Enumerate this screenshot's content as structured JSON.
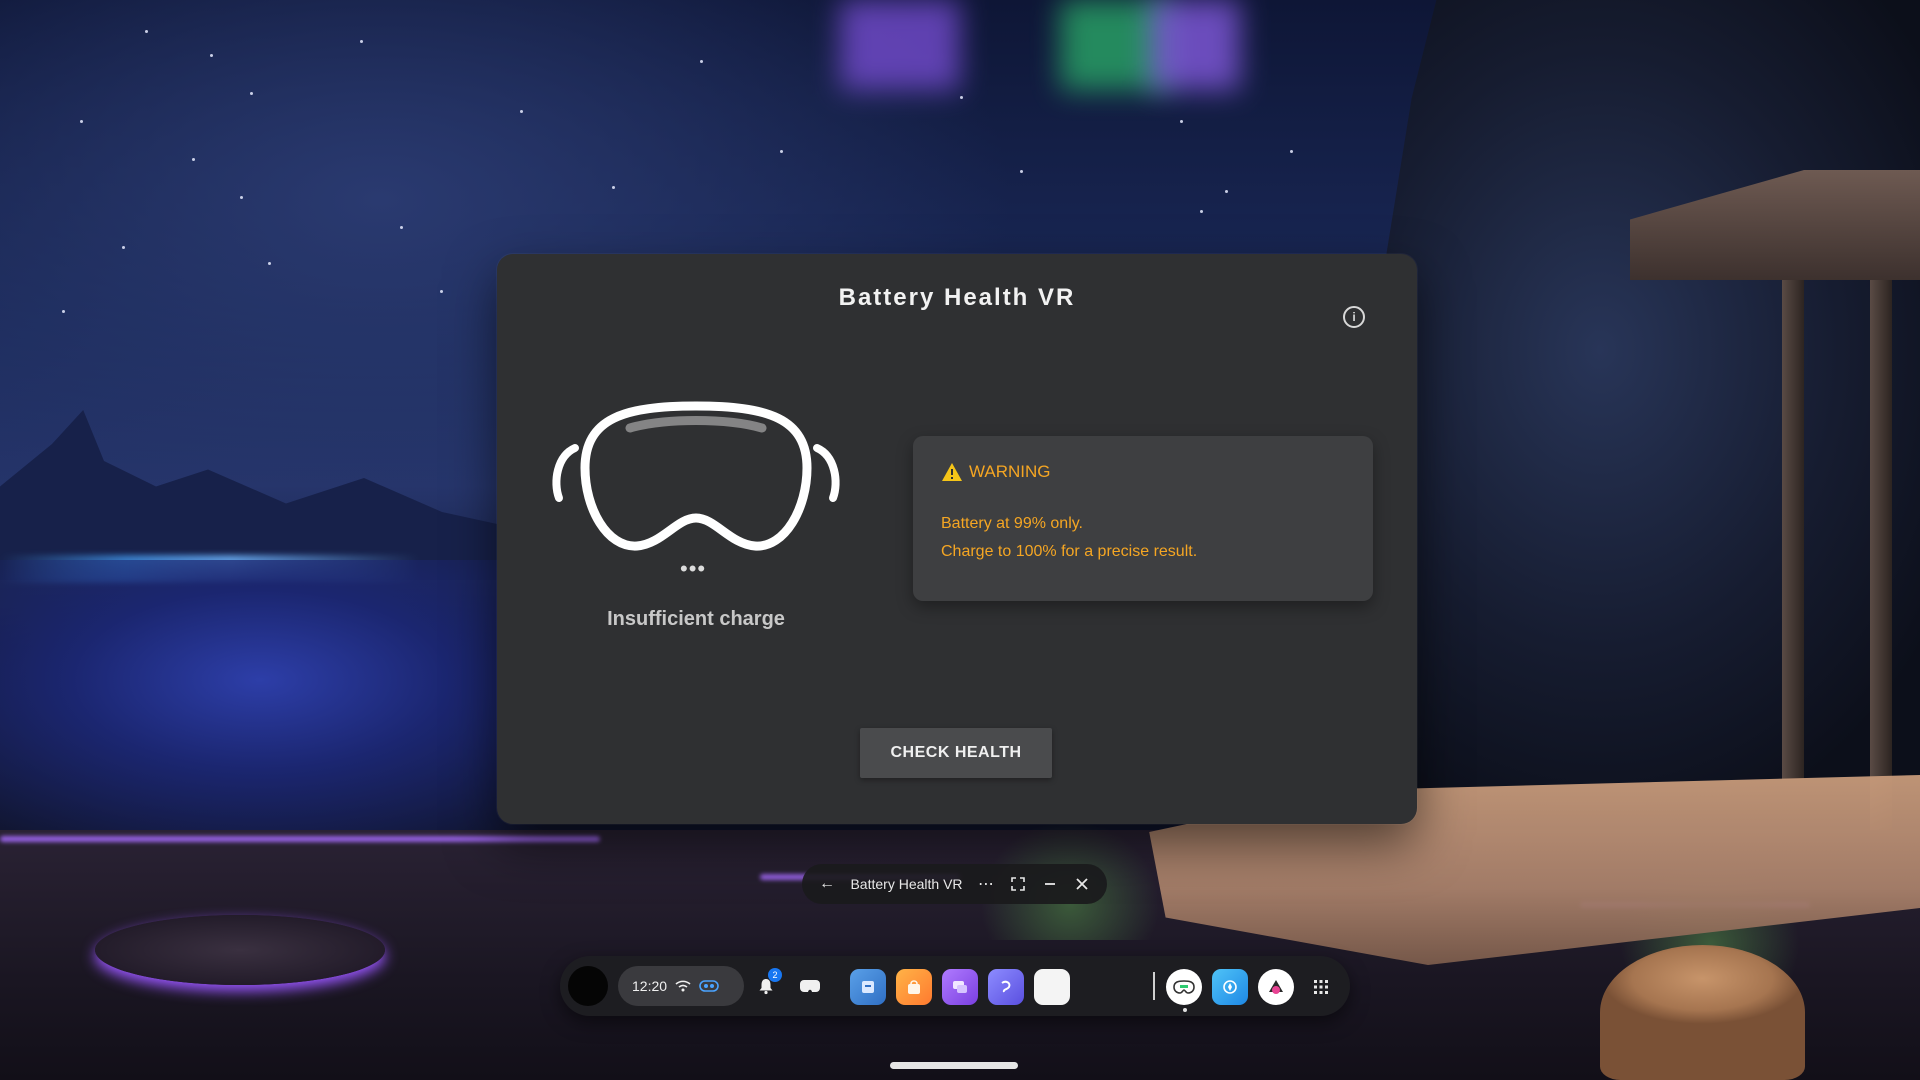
{
  "app": {
    "title": "Battery Health VR",
    "status_label": "Insufficient charge",
    "dots": "•••",
    "info_icon": "info-icon",
    "warning": {
      "heading": "WARNING",
      "line1": "Battery at 99% only.",
      "line2": "Charge to 100% for a precise result.",
      "color": "#f5a623"
    },
    "action_label": "CHECK HEALTH"
  },
  "window_bar": {
    "title": "Battery Health VR",
    "icons": [
      "back-arrow-icon",
      "more-icon",
      "expand-icon",
      "minimize-icon",
      "close-icon"
    ]
  },
  "taskbar": {
    "time": "12:20",
    "notification_count": "2",
    "apps": [
      "files-icon",
      "store-icon",
      "messenger-icon",
      "horizon-icon",
      "blank-app-icon",
      "battery-health-icon",
      "explore-icon",
      "game-icon",
      "app-library-icon"
    ]
  },
  "colors": {
    "panel_bg": "#2f3032",
    "card_bg": "#3e3f41",
    "accent_warning": "#f5a623",
    "button_bg": "#4a4b4d"
  }
}
